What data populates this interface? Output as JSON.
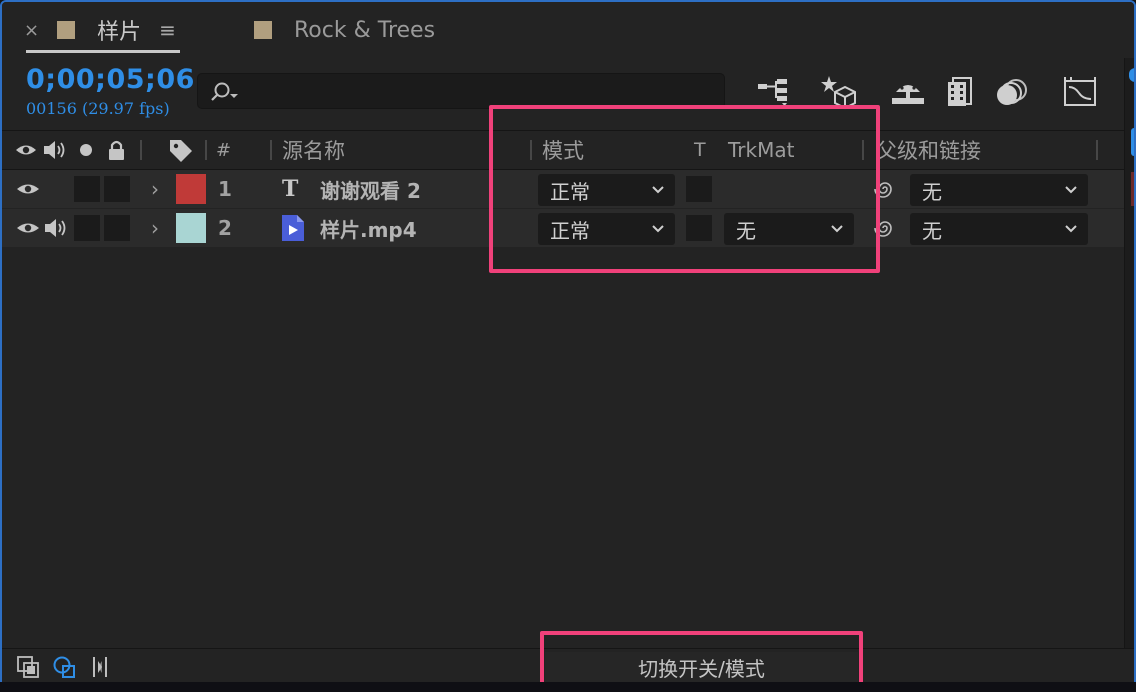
{
  "tabs": [
    {
      "label": "样片",
      "active": true,
      "swatch_color": "#b19f7f"
    },
    {
      "label": "Rock & Trees",
      "active": false,
      "swatch_color": "#b19f7f"
    }
  ],
  "tab_close_glyph": "×",
  "tab_menu_glyph": "≡",
  "timecode": "0;00;05;06",
  "frame_info": "00156 (29.97 fps)",
  "search": {
    "value": "",
    "placeholder": ""
  },
  "columns": {
    "name": "源名称",
    "hash": "#",
    "mode": "模式",
    "t": "T",
    "trkmat": "TrkMat",
    "parent": "父级和链接"
  },
  "layers": [
    {
      "index": "1",
      "name": "谢谢观看 2",
      "type": "text",
      "color": "#c03a38",
      "mode": "正常",
      "trkmat": "",
      "parent": "无",
      "has_audio": false
    },
    {
      "index": "2",
      "name": "样片.mp4",
      "type": "video",
      "color": "#a9d5d3",
      "mode": "正常",
      "trkmat": "无",
      "parent": "无",
      "has_audio": true
    }
  ],
  "footer": {
    "toggle_label": "切换开关/模式"
  },
  "colors": {
    "accent_blue": "#2f8ee6",
    "highlight": "#f0417a",
    "panel_bg": "#232323"
  }
}
